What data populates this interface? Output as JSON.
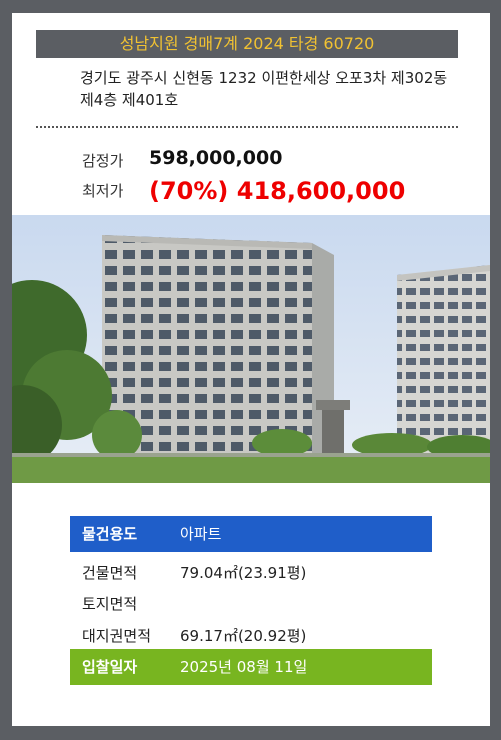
{
  "header": {
    "court_case": "성남지원 경매7계 2024 타경 60720"
  },
  "address": "경기도 광주시 신현동 1232 이편한세상 오포3차 제302동 제4층 제401호",
  "prices": {
    "appraisal_label": "감정가",
    "appraisal_value": "598,000,000",
    "minimum_label": "최저가",
    "minimum_value": "(70%) 418,600,000"
  },
  "photo": {
    "description_icon": "apartment-building-photo"
  },
  "details": {
    "usage_label": "물건용도",
    "usage_value": "아파트",
    "building_area_label": "건물면적",
    "building_area_value": "79.04㎡(23.91평)",
    "land_area_label": "토지면적",
    "land_area_value": "",
    "land_rights_label": "대지권면적",
    "land_rights_value": "69.17㎡(20.92평)",
    "bid_date_label": "입찰일자",
    "bid_date_value": "2025년 08월 11일"
  },
  "colors": {
    "background": "#5b5e63",
    "header_text": "#f1c232",
    "minimum_price": "#ee0000",
    "usage_row": "#1f5ec9",
    "bid_row": "#78b520"
  }
}
